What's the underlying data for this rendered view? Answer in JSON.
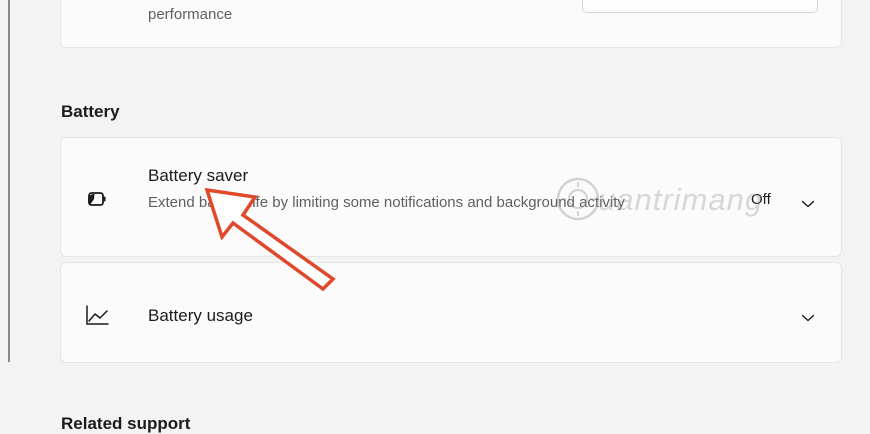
{
  "performance_card": {
    "description_tail": "performance"
  },
  "battery_section": {
    "title": "Battery",
    "battery_saver": {
      "title": "Battery saver",
      "description": "Extend battery life by limiting some notifications and background activity",
      "status": "Off",
      "icon": "battery-saver-icon"
    },
    "battery_usage": {
      "title": "Battery usage",
      "icon": "line-chart-icon"
    }
  },
  "related_support": {
    "title": "Related support"
  },
  "watermark": {
    "text": "uantrimang"
  },
  "annotation": {
    "arrow_color": "#e0482b"
  }
}
